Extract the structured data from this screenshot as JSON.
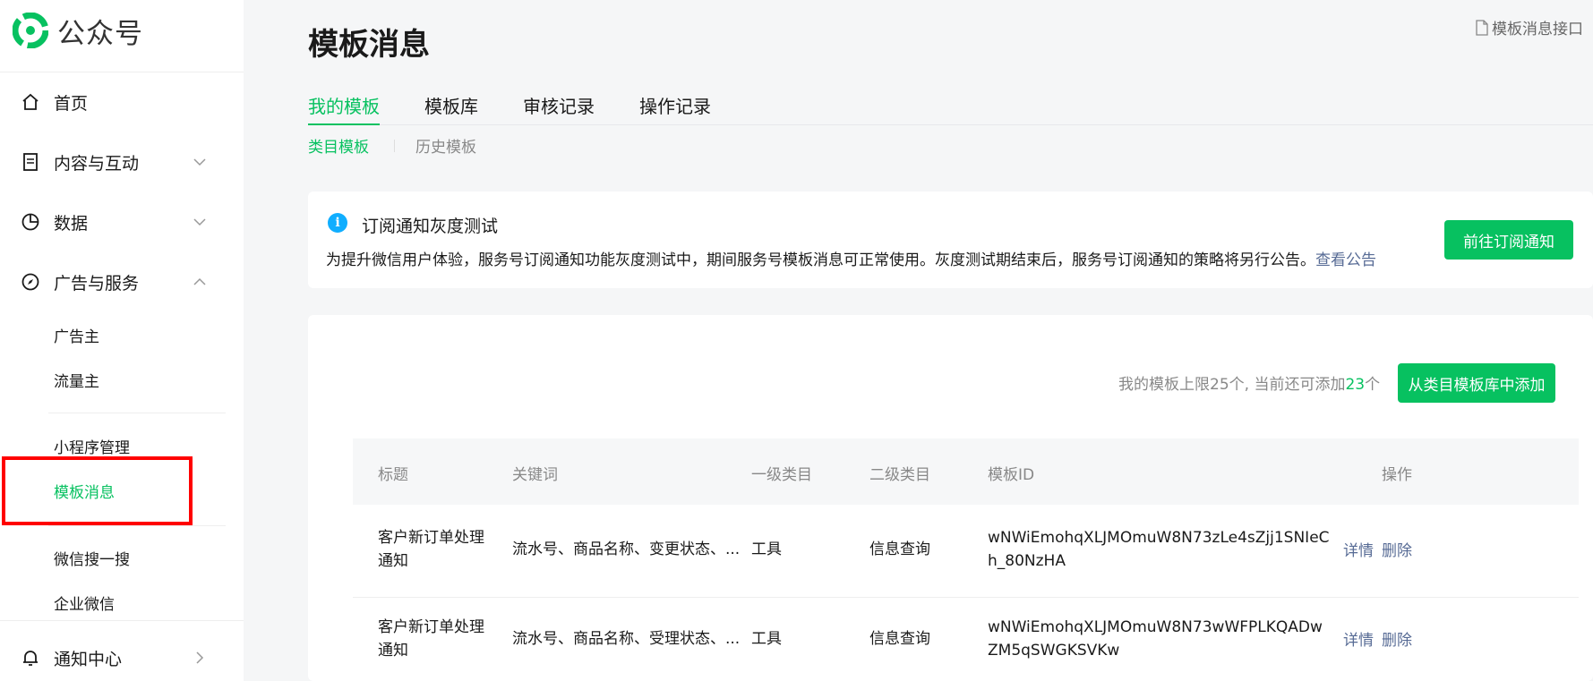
{
  "brand": {
    "name": "公众号",
    "logo_icon": "wechat-official-account-logo"
  },
  "colors": {
    "accent": "#07c160",
    "link": "#576b95",
    "info": "#10aeff",
    "highlight": "#ff0000"
  },
  "sidebar": {
    "nav": [
      {
        "label": "首页",
        "icon": "home-icon"
      },
      {
        "label": "内容与互动",
        "icon": "document-icon",
        "arrow": "chevron-down-icon"
      },
      {
        "label": "数据",
        "icon": "pie-chart-icon",
        "arrow": "chevron-down-icon"
      },
      {
        "label": "广告与服务",
        "icon": "compass-icon",
        "arrow": "chevron-up-icon"
      }
    ],
    "sub": [
      {
        "label": "广告主"
      },
      {
        "label": "流量主"
      },
      {
        "label": "小程序管理"
      },
      {
        "label": "模板消息"
      },
      {
        "label": "微信搜一搜"
      },
      {
        "label": "企业微信"
      }
    ],
    "notifications": {
      "label": "通知中心",
      "icon": "bell-icon",
      "arrow": "chevron-right-icon"
    }
  },
  "page": {
    "title": "模板消息",
    "doc_link": "模板消息接口"
  },
  "tabs": [
    "我的模板",
    "模板库",
    "审核记录",
    "操作记录"
  ],
  "subtabs": [
    "类目模板",
    "历史模板"
  ],
  "notice": {
    "title": "订阅通知灰度测试",
    "text": "为提升微信用户体验，服务号订阅通知功能灰度测试中，期间服务号模板消息可正常使用。灰度测试期结束后，服务号订阅通知的策略将另行公告。",
    "link": "查看公告",
    "button": "前往订阅通知"
  },
  "quota": {
    "prefix": "我的模板上限25个, 当前还可添加",
    "remaining": "23",
    "suffix": "个"
  },
  "add_button": "从类目模板库中添加",
  "table": {
    "headers": [
      "标题",
      "关键词",
      "一级类目",
      "二级类目",
      "模板ID",
      "操作"
    ],
    "rows": [
      {
        "title_l1": "客户新订单处理",
        "title_l2": "通知",
        "keywords": "流水号、商品名称、变更状态、...",
        "cat1": "工具",
        "cat2": "信息查询",
        "id_l1": "wNWiEmohqXLJMOmuW8N73zLe4sZjj1SNIeC",
        "id_l2": "h_80NzHA",
        "op_detail": "详情",
        "op_delete": "删除"
      },
      {
        "title_l1": "客户新订单处理",
        "title_l2": "通知",
        "keywords": "流水号、商品名称、受理状态、...",
        "cat1": "工具",
        "cat2": "信息查询",
        "id_l1": "wNWiEmohqXLJMOmuW8N73wWFPLKQADw",
        "id_l2": "ZM5qSWGKSVKw",
        "op_detail": "详情",
        "op_delete": "删除"
      }
    ]
  }
}
